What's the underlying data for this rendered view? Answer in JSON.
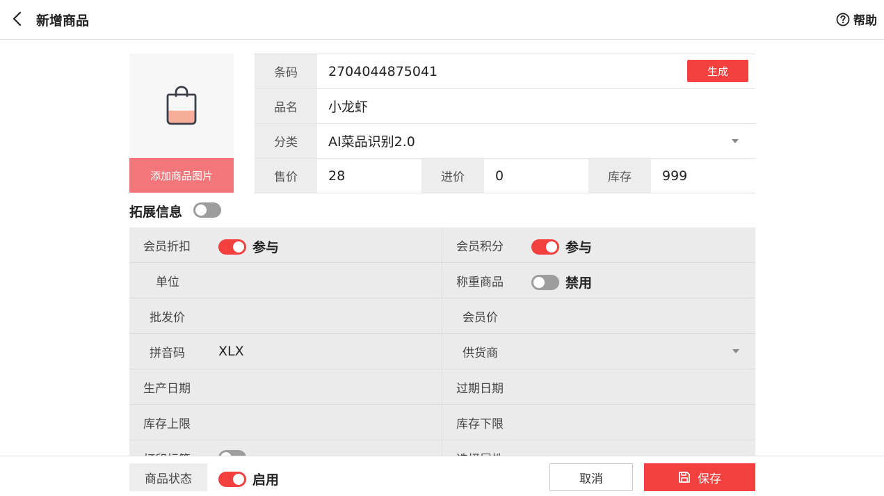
{
  "header": {
    "title": "新增商品",
    "help_label": "帮助"
  },
  "image": {
    "add_label": "添加商品图片"
  },
  "form": {
    "barcode_label": "条码",
    "barcode_value": "2704044875041",
    "generate_label": "生成",
    "name_label": "品名",
    "name_value": "小龙虾",
    "category_label": "分类",
    "category_value": "AI菜品识别2.0",
    "price_label": "售价",
    "price_value": "28",
    "cost_label": "进价",
    "cost_value": "0",
    "stock_label": "库存",
    "stock_value": "999"
  },
  "extension": {
    "title": "拓展信息",
    "enabled": false,
    "rows": [
      {
        "left": {
          "label": "会员折扣",
          "toggle": true,
          "state": "参与"
        },
        "right": {
          "label": "会员积分",
          "toggle": true,
          "state": "参与"
        }
      },
      {
        "left": {
          "label": "单位"
        },
        "right": {
          "label": "称重商品",
          "toggle": false,
          "state": "禁用"
        }
      },
      {
        "left": {
          "label": "批发价"
        },
        "right": {
          "label": "会员价"
        }
      },
      {
        "left": {
          "label": "拼音码",
          "value": "XLX"
        },
        "right": {
          "label": "供货商"
        }
      },
      {
        "left": {
          "label": "生产日期"
        },
        "right": {
          "label": "过期日期"
        }
      },
      {
        "left": {
          "label": "库存上限"
        },
        "right": {
          "label": "库存下限"
        }
      },
      {
        "left": {
          "label": "打印标签"
        },
        "right": {
          "label": "选择属性"
        }
      }
    ]
  },
  "footer": {
    "status_label": "商品状态",
    "status_state": "启用",
    "cancel_label": "取消",
    "save_label": "保存"
  },
  "colors": {
    "accent": "#f43f3f",
    "image_button": "#f2767a",
    "toggle_off": "#9d9d9d"
  }
}
